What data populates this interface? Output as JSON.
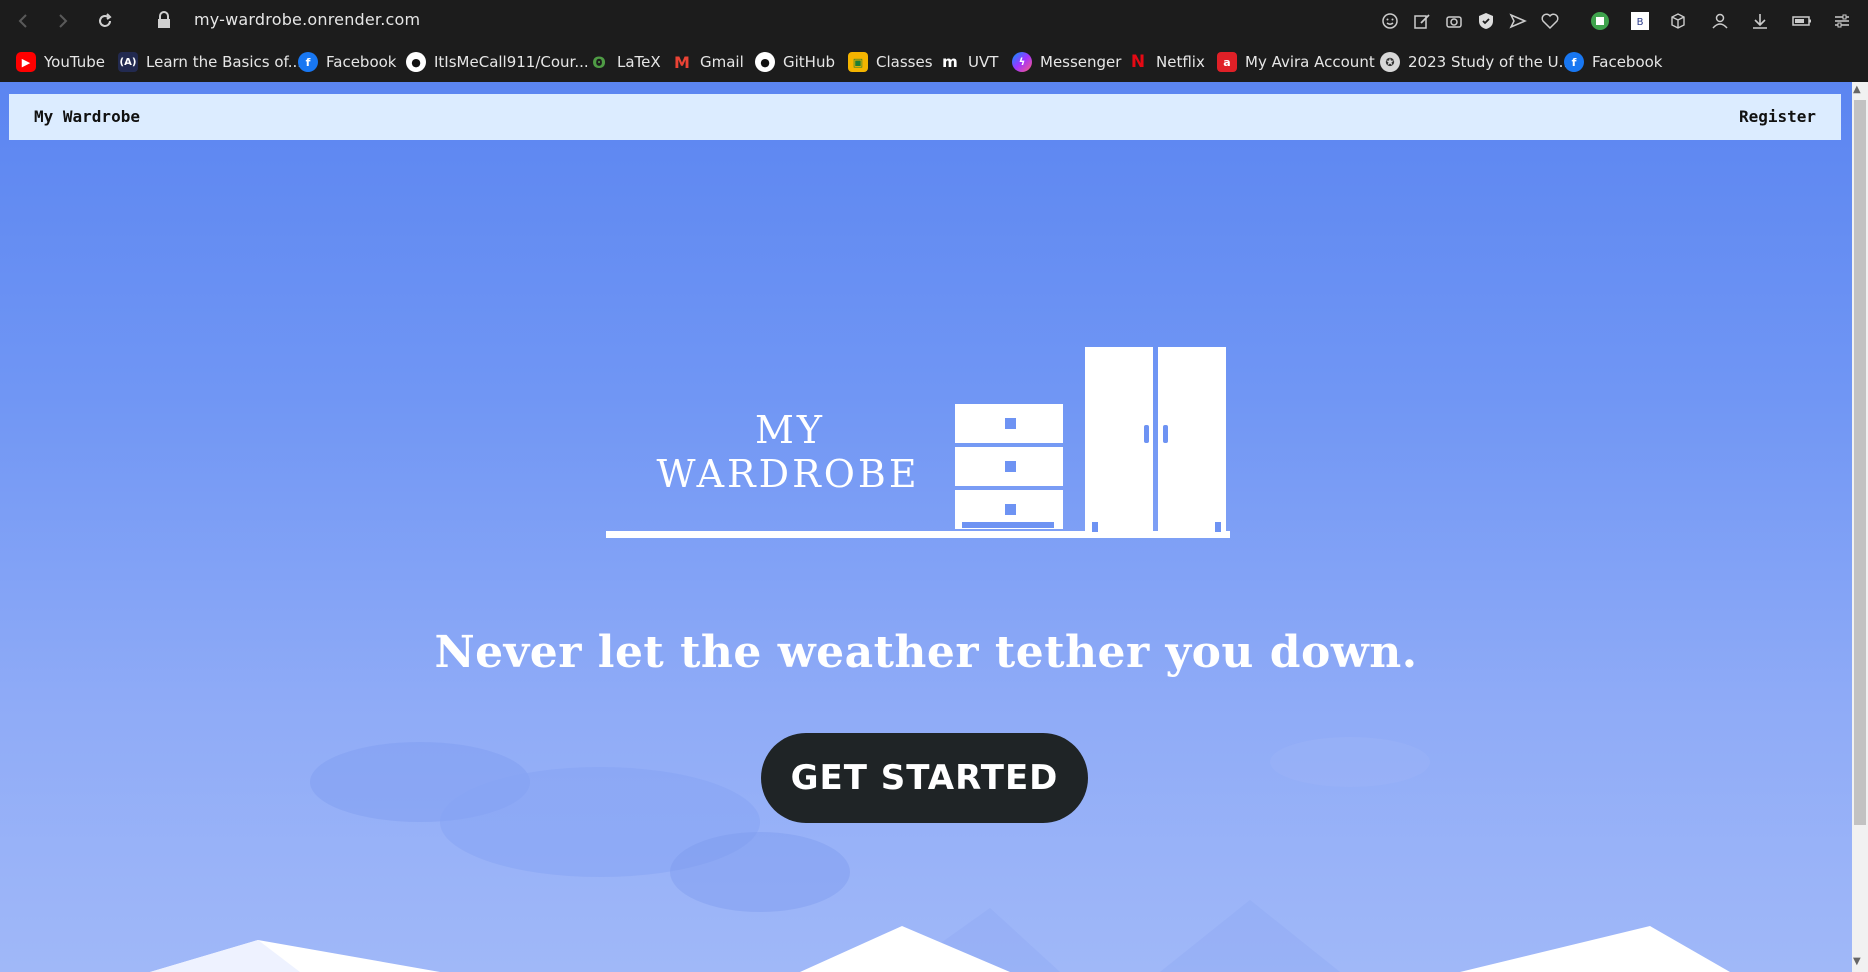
{
  "browser": {
    "url": "my-wardrobe.onrender.com"
  },
  "bookmarks": [
    {
      "label": "YouTube",
      "icon": "youtube-icon",
      "color": "#ff0000"
    },
    {
      "label": "Learn the Basics of...",
      "icon": "react-icon",
      "color": "#222a50"
    },
    {
      "label": "Facebook",
      "icon": "facebook-icon",
      "color": "#1877f2"
    },
    {
      "label": "ItIsMeCall911/Cour...",
      "icon": "github-icon",
      "color": "#ffffff"
    },
    {
      "label": "LaTeX",
      "icon": "overleaf-icon",
      "color": "#4f9c45"
    },
    {
      "label": "Gmail",
      "icon": "gmail-icon",
      "color": "#ea4335"
    },
    {
      "label": "GitHub",
      "icon": "github-icon",
      "color": "#ffffff"
    },
    {
      "label": "Classes",
      "icon": "classroom-icon",
      "color": "#f4b400"
    },
    {
      "label": "UVT",
      "icon": "moodle-icon",
      "color": "#ffffff"
    },
    {
      "label": "Messenger",
      "icon": "messenger-icon",
      "color": "#a033ff"
    },
    {
      "label": "Netflix",
      "icon": "netflix-icon",
      "color": "#e50914"
    },
    {
      "label": "My Avira Account",
      "icon": "avira-icon",
      "color": "#e02027"
    },
    {
      "label": "2023 Study of the U...",
      "icon": "seal-icon",
      "color": "#bbbbbb"
    },
    {
      "label": "Facebook",
      "icon": "facebook-icon",
      "color": "#1877f2"
    }
  ],
  "site": {
    "brand": "My Wardrobe",
    "register": "Register",
    "logo_line1": "MY",
    "logo_line2": "WARDROBE",
    "tagline": "Never let the weather tether you down.",
    "cta": "GET STARTED"
  },
  "colors": {
    "nav_bg": "#dcecff",
    "hero_top": "#5b85f1",
    "hero_bottom": "#a0b8f8",
    "cta_bg": "#1f2426"
  }
}
